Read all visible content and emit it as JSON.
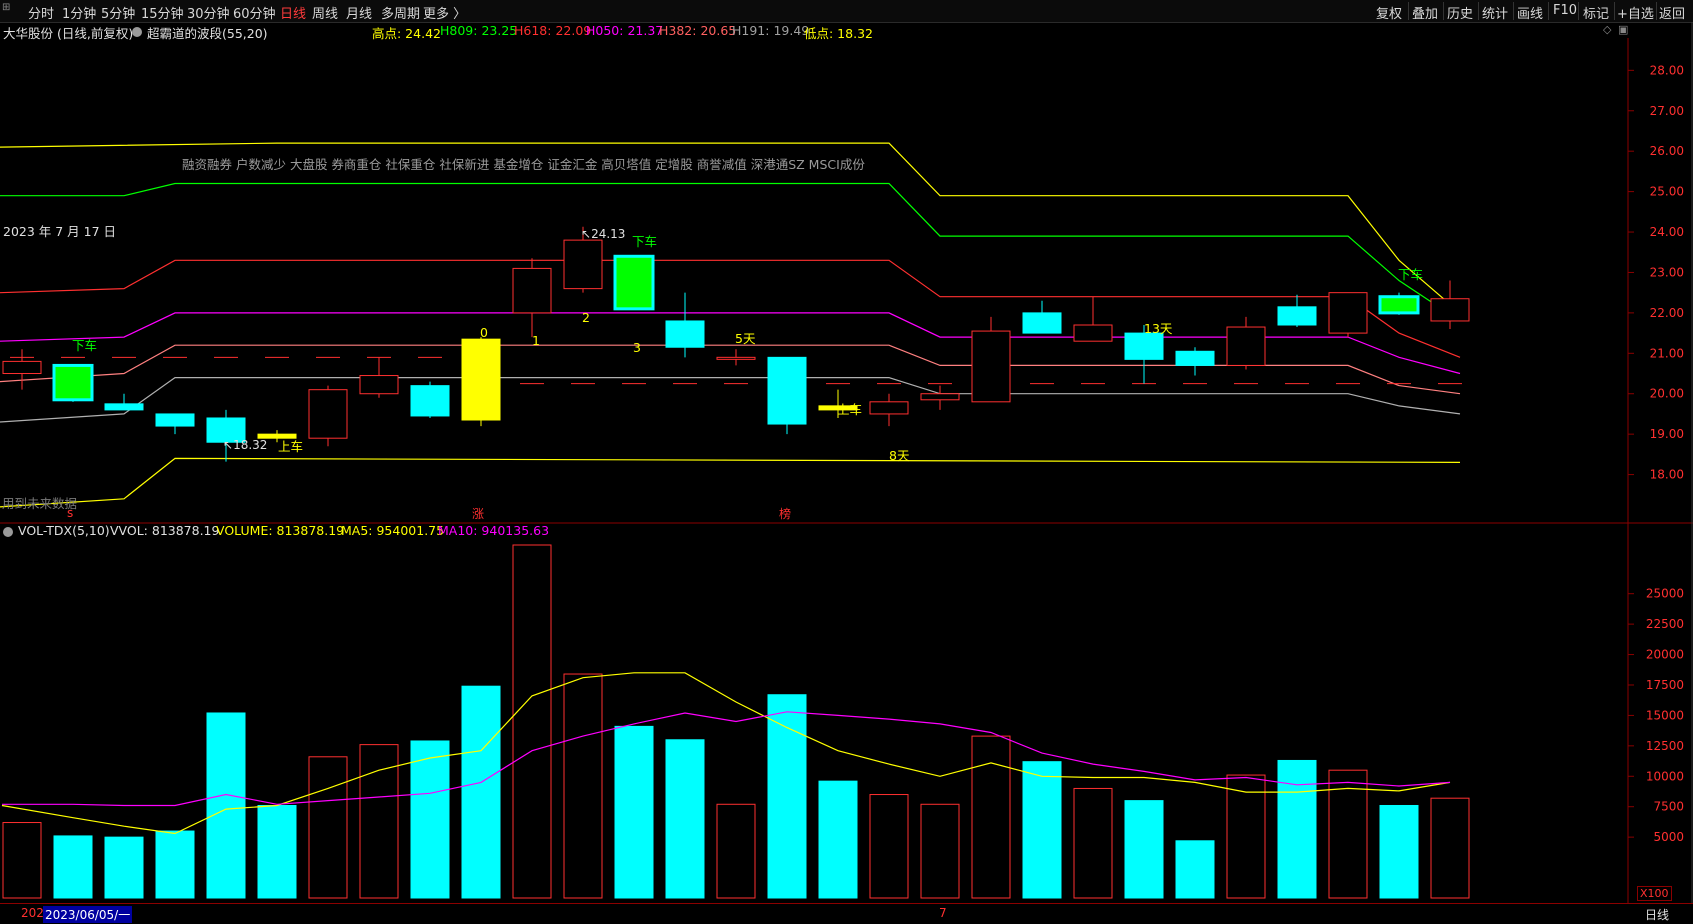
{
  "toolbar": {
    "periods": [
      "分时",
      "1分钟",
      "5分钟",
      "15分钟",
      "30分钟",
      "60分钟",
      "日线",
      "周线",
      "月线",
      "多周期",
      "更多 〉"
    ],
    "active_period": "日线",
    "right_buttons": [
      "复权",
      "叠加",
      "历史",
      "统计",
      "画线",
      "F10",
      "标记",
      "+自选",
      "返回"
    ]
  },
  "header": {
    "stock_title": "大华股份 (日线,前复权)",
    "indicator": "超霸道的波段(55,20)",
    "levels": [
      {
        "label": "高点: 24.42",
        "color": "#ffff00"
      },
      {
        "label": "H809: 23.25",
        "color": "#00ff00"
      },
      {
        "label": "H618: 22.09",
        "color": "#ff3030"
      },
      {
        "label": "H050: 21.37",
        "color": "#ff00ff"
      },
      {
        "label": "H382: 20.65",
        "color": "#ff6060"
      },
      {
        "label": "H191: 19.49",
        "color": "#a0a0a0"
      },
      {
        "label": "低点: 18.32",
        "color": "#ffff00"
      }
    ]
  },
  "concepts": "融资融券 户数减少 大盘股 券商重仓 社保重仓 社保新进 基金增仓 证金汇金 高贝塔值 定增股 商誉减值 深港通SZ MSCI成份",
  "date_label": "2023 年 7 月 17 日",
  "future_data_label": "用到未来数据",
  "markers": {
    "s": "s",
    "zhang": "涨",
    "bang": "榜"
  },
  "price_axis": [
    "28.00",
    "27.00",
    "26.00",
    "25.00",
    "24.00",
    "23.00",
    "22.00",
    "21.00",
    "20.00",
    "19.00",
    "18.00"
  ],
  "annotations": {
    "high_label": "24.13",
    "low_label": "18.32",
    "xiache": "下车",
    "shangche": "上车",
    "n0": "0",
    "n1": "1",
    "n2": "2",
    "n3": "3",
    "d5": "5天",
    "d8": "8天",
    "d13": "13天"
  },
  "volume_header": {
    "name": "VOL-TDX(5,10)",
    "vvol": "VVOL: 813878.19",
    "volume": "VOLUME: 813878.19",
    "ma5": "MA5: 954001.75",
    "ma10": "MA10: 940135.63"
  },
  "volume_axis": [
    "25000",
    "22500",
    "20000",
    "17500",
    "15000",
    "12500",
    "10000",
    "7500",
    "5000"
  ],
  "volume_unit": "X100",
  "status": {
    "left": "202",
    "date": "2023/06/05/一",
    "mid": "7",
    "period": "日线"
  },
  "colors": {
    "up": "#ff3030",
    "down": "#00ffff",
    "bg": "#000000",
    "yellow": "#ffff00",
    "green": "#00ff00",
    "magenta": "#ff00ff"
  },
  "chart_data": {
    "type": "candlestick",
    "price_range": [
      17.0,
      28.8
    ],
    "candles": [
      {
        "o": 20.5,
        "h": 21.1,
        "l": 20.1,
        "c": 20.8,
        "kind": "up"
      },
      {
        "o": 20.7,
        "h": 20.7,
        "l": 19.8,
        "c": 19.85,
        "kind": "green"
      },
      {
        "o": 19.75,
        "h": 20.0,
        "l": 19.6,
        "c": 19.6,
        "kind": "down"
      },
      {
        "o": 19.5,
        "h": 19.5,
        "l": 19.0,
        "c": 19.2,
        "kind": "down"
      },
      {
        "o": 19.4,
        "h": 19.6,
        "l": 18.32,
        "c": 18.8,
        "kind": "down"
      },
      {
        "o": 19.0,
        "h": 19.1,
        "l": 18.8,
        "c": 18.9,
        "kind": "yellow"
      },
      {
        "o": 18.9,
        "h": 20.2,
        "l": 18.7,
        "c": 20.1,
        "kind": "up"
      },
      {
        "o": 20.0,
        "h": 20.9,
        "l": 19.9,
        "c": 20.45,
        "kind": "up"
      },
      {
        "o": 20.2,
        "h": 20.3,
        "l": 19.4,
        "c": 19.45,
        "kind": "down"
      },
      {
        "o": 19.35,
        "h": 21.4,
        "l": 19.2,
        "c": 21.35,
        "kind": "yellow"
      },
      {
        "o": 22.0,
        "h": 23.35,
        "l": 21.4,
        "c": 23.1,
        "kind": "up"
      },
      {
        "o": 22.6,
        "h": 24.13,
        "l": 22.5,
        "c": 23.8,
        "kind": "up"
      },
      {
        "o": 23.4,
        "h": 23.4,
        "l": 22.1,
        "c": 22.1,
        "kind": "green"
      },
      {
        "o": 21.8,
        "h": 22.5,
        "l": 20.9,
        "c": 21.15,
        "kind": "down"
      },
      {
        "o": 20.9,
        "h": 21.1,
        "l": 20.7,
        "c": 20.9,
        "kind": "up"
      },
      {
        "o": 20.9,
        "h": 20.9,
        "l": 19.0,
        "c": 19.25,
        "kind": "down"
      },
      {
        "o": 19.7,
        "h": 20.1,
        "l": 19.4,
        "c": 19.6,
        "kind": "yellow"
      },
      {
        "o": 19.5,
        "h": 20.0,
        "l": 19.2,
        "c": 19.8,
        "kind": "up"
      },
      {
        "o": 19.85,
        "h": 20.2,
        "l": 19.6,
        "c": 20.0,
        "kind": "up"
      },
      {
        "o": 19.8,
        "h": 21.9,
        "l": 19.8,
        "c": 21.55,
        "kind": "up"
      },
      {
        "o": 22.0,
        "h": 22.3,
        "l": 21.5,
        "c": 21.5,
        "kind": "down"
      },
      {
        "o": 21.3,
        "h": 22.4,
        "l": 21.3,
        "c": 21.7,
        "kind": "up"
      },
      {
        "o": 21.5,
        "h": 21.7,
        "l": 20.25,
        "c": 20.85,
        "kind": "down"
      },
      {
        "o": 21.05,
        "h": 21.15,
        "l": 20.45,
        "c": 20.7,
        "kind": "down"
      },
      {
        "o": 20.7,
        "h": 21.9,
        "l": 20.6,
        "c": 21.65,
        "kind": "up"
      },
      {
        "o": 22.15,
        "h": 22.45,
        "l": 21.65,
        "c": 21.7,
        "kind": "down"
      },
      {
        "o": 21.5,
        "h": 22.5,
        "l": 21.4,
        "c": 22.5,
        "kind": "up"
      },
      {
        "o": 22.4,
        "h": 22.5,
        "l": 21.95,
        "c": 22.0,
        "kind": "green"
      },
      {
        "o": 21.8,
        "h": 22.8,
        "l": 21.6,
        "c": 22.35,
        "kind": "up"
      }
    ],
    "volumes": [
      6200,
      5100,
      5000,
      5500,
      15200,
      7600,
      11600,
      12600,
      12900,
      17400,
      29000,
      18400,
      14100,
      13000,
      7700,
      16700,
      9600,
      8500,
      7700,
      13300,
      11200,
      9000,
      8000,
      4700,
      10100,
      11300,
      10500,
      7600,
      8200
    ],
    "volume_range": [
      0,
      29000
    ],
    "ma5": [
      7600,
      6600,
      5900,
      5300,
      7300,
      7600,
      9000,
      10500,
      11500,
      12100,
      16600,
      18100,
      18500,
      18500,
      16100,
      14000,
      12100,
      11000,
      10000,
      11100,
      10000,
      9900,
      9900,
      9500,
      8700,
      8700,
      9000,
      8800,
      9500
    ],
    "ma10": [
      7700,
      7700,
      7600,
      7600,
      8500,
      7700,
      8000,
      8300,
      8600,
      9500,
      12100,
      13300,
      14300,
      15200,
      14500,
      15300,
      15000,
      14700,
      14300,
      13600,
      11900,
      11000,
      10400,
      9700,
      9900,
      9300,
      9500,
      9200,
      9500
    ],
    "levels": [
      {
        "name": "高点",
        "color": "#ffff00",
        "pts": [
          [
            0,
            26.1
          ],
          [
            5,
            26.2
          ],
          [
            17,
            26.2
          ],
          [
            18,
            24.9
          ],
          [
            26,
            24.9
          ],
          [
            27,
            23.3
          ],
          [
            28,
            22.0
          ]
        ]
      },
      {
        "name": "H809",
        "color": "#00ff00",
        "pts": [
          [
            0,
            24.9
          ],
          [
            2,
            24.9
          ],
          [
            3,
            25.2
          ],
          [
            17,
            25.2
          ],
          [
            18,
            23.9
          ],
          [
            26,
            23.9
          ],
          [
            27,
            22.8
          ],
          [
            28,
            21.8
          ]
        ]
      },
      {
        "name": "H618",
        "color": "#ff3030",
        "pts": [
          [
            0,
            22.5
          ],
          [
            2,
            22.6
          ],
          [
            3,
            23.3
          ],
          [
            17,
            23.3
          ],
          [
            18,
            22.4
          ],
          [
            26,
            22.4
          ],
          [
            27,
            21.5
          ],
          [
            28,
            20.9
          ]
        ]
      },
      {
        "name": "H050",
        "color": "#ff00ff",
        "pts": [
          [
            0,
            21.3
          ],
          [
            2,
            21.4
          ],
          [
            3,
            22.0
          ],
          [
            17,
            22.0
          ],
          [
            18,
            21.4
          ],
          [
            26,
            21.4
          ],
          [
            27,
            20.9
          ],
          [
            28,
            20.5
          ]
        ]
      },
      {
        "name": "H382",
        "color": "#ff8080",
        "pts": [
          [
            0,
            20.3
          ],
          [
            2,
            20.5
          ],
          [
            3,
            21.2
          ],
          [
            17,
            21.2
          ],
          [
            18,
            20.7
          ],
          [
            26,
            20.7
          ],
          [
            27,
            20.2
          ],
          [
            28,
            20.0
          ]
        ]
      },
      {
        "name": "H191",
        "color": "#b0b0b0",
        "pts": [
          [
            0,
            19.3
          ],
          [
            2,
            19.5
          ],
          [
            3,
            20.4
          ],
          [
            17,
            20.4
          ],
          [
            18,
            20.0
          ],
          [
            26,
            20.0
          ],
          [
            27,
            19.7
          ],
          [
            28,
            19.5
          ]
        ]
      },
      {
        "name": "低点",
        "color": "#ffff00",
        "pts": [
          [
            0,
            17.2
          ],
          [
            2,
            17.4
          ],
          [
            3,
            18.4
          ],
          [
            28,
            18.3
          ]
        ]
      }
    ],
    "dashed": [
      {
        "color": "#ff3030",
        "value": 20.9,
        "from": 0,
        "to": 8
      },
      {
        "color": "#ff3030",
        "value": 20.25,
        "from": 9,
        "to": 28
      }
    ]
  }
}
